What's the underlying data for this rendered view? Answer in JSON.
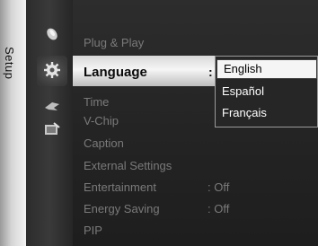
{
  "side_tab": {
    "label": "Setup"
  },
  "menu": {
    "items": [
      {
        "label": "Plug & Play",
        "value": ""
      },
      {
        "label": "Language",
        "value": ":"
      },
      {
        "label": "Time",
        "value": ""
      },
      {
        "label": "V-Chip",
        "value": ""
      },
      {
        "label": "Caption",
        "value": ""
      },
      {
        "label": "External Settings",
        "value": ""
      },
      {
        "label": "Entertainment",
        "value": ": Off"
      },
      {
        "label": "Energy Saving",
        "value": ": Off"
      },
      {
        "label": "PIP",
        "value": ""
      }
    ],
    "selected_index": 1
  },
  "language_dropdown": {
    "options": [
      "English",
      "Español",
      "Français"
    ],
    "selected": "English"
  },
  "icons": [
    "picture-icon",
    "setup-gear-icon",
    "input-icon",
    "support-icon"
  ],
  "colors": {
    "highlight": "#f6f6f6",
    "text_dim": "#7a7a7a",
    "text_active": "#0a0a0a"
  }
}
